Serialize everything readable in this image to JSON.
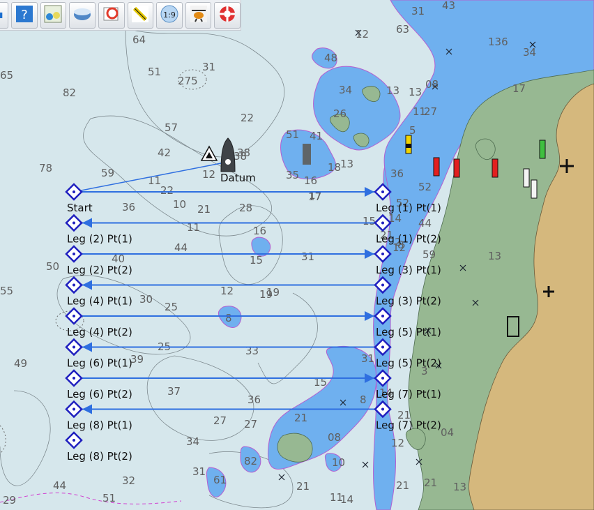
{
  "toolbar": {
    "buttons": [
      {
        "icon": "partial-button-icon"
      },
      {
        "icon": "help-icon"
      },
      {
        "icon": "chart-info-icon"
      },
      {
        "icon": "chart-database-icon"
      },
      {
        "icon": "chart-tide-icon"
      },
      {
        "icon": "measure-ruler-icon"
      },
      {
        "icon": "zoom-scale-icon",
        "text": "1:9"
      },
      {
        "icon": "helicopter-icon"
      },
      {
        "icon": "lifebuoy-icon"
      }
    ]
  },
  "soundings": [
    "64",
    "51",
    "31",
    "65",
    "82",
    "275",
    "22",
    "57",
    "42",
    "38",
    "78",
    "59",
    "11",
    "22",
    "12",
    "36",
    "10",
    "21",
    "28",
    "44",
    "11",
    "16",
    "40",
    "50",
    "30",
    "25",
    "12",
    "19",
    "55",
    "8",
    "31",
    "17",
    "33",
    "25",
    "49",
    "39",
    "37",
    "36",
    "27",
    "27",
    "21",
    "15",
    "15",
    "34",
    "31",
    "32",
    "44",
    "51",
    "29",
    "61",
    "82",
    "21",
    "10",
    "11",
    "14",
    "12",
    "21",
    "13",
    "08",
    "21",
    "27",
    "17",
    "5",
    "8",
    "12",
    "14",
    "136",
    "31",
    "48",
    "34",
    "26",
    "18",
    "13",
    "17",
    "31",
    "52",
    "04",
    "36",
    "63",
    "21",
    "08",
    "13",
    "34",
    "12",
    "44",
    "15",
    "11",
    "51",
    "13",
    "21",
    "52",
    "59",
    "3",
    "2",
    "13",
    "43",
    "8",
    "14",
    "19",
    "38",
    "41",
    "35",
    "16"
  ],
  "route": {
    "boat_label": "Datum",
    "points": [
      {
        "label": "Start",
        "side": "left"
      },
      {
        "label": "Leg (1) Pt(1)",
        "side": "right"
      },
      {
        "label": "Leg (1) Pt(2)",
        "side": "right"
      },
      {
        "label": "Leg (2) Pt(1)",
        "side": "left"
      },
      {
        "label": "Leg (2) Pt(2)",
        "side": "left"
      },
      {
        "label": "Leg (3) Pt(1)",
        "side": "right"
      },
      {
        "label": "Leg (3) Pt(2)",
        "side": "right"
      },
      {
        "label": "Leg (4) Pt(1)",
        "side": "left"
      },
      {
        "label": "Leg (4) Pt(2)",
        "side": "left"
      },
      {
        "label": "Leg (5) Pt(1)",
        "side": "right"
      },
      {
        "label": "Leg (5) Pt(2)",
        "side": "right"
      },
      {
        "label": "Leg (6) Pt(1)",
        "side": "left"
      },
      {
        "label": "Leg (6) Pt(2)",
        "side": "left"
      },
      {
        "label": "Leg (7) Pt(1)",
        "side": "right"
      },
      {
        "label": "Leg (7) Pt(2)",
        "side": "right"
      },
      {
        "label": "Leg (8) Pt(1)",
        "side": "left"
      },
      {
        "label": "Leg (8) Pt(2)",
        "side": "left"
      }
    ]
  },
  "colors": {
    "deep_water": "#d6e7ec",
    "shallow_water": "#6fb0ef",
    "land": "#d5b87d",
    "intertidal": "#97b892",
    "route": "#2f6fe0",
    "waypoint": "#1f1fbf"
  }
}
